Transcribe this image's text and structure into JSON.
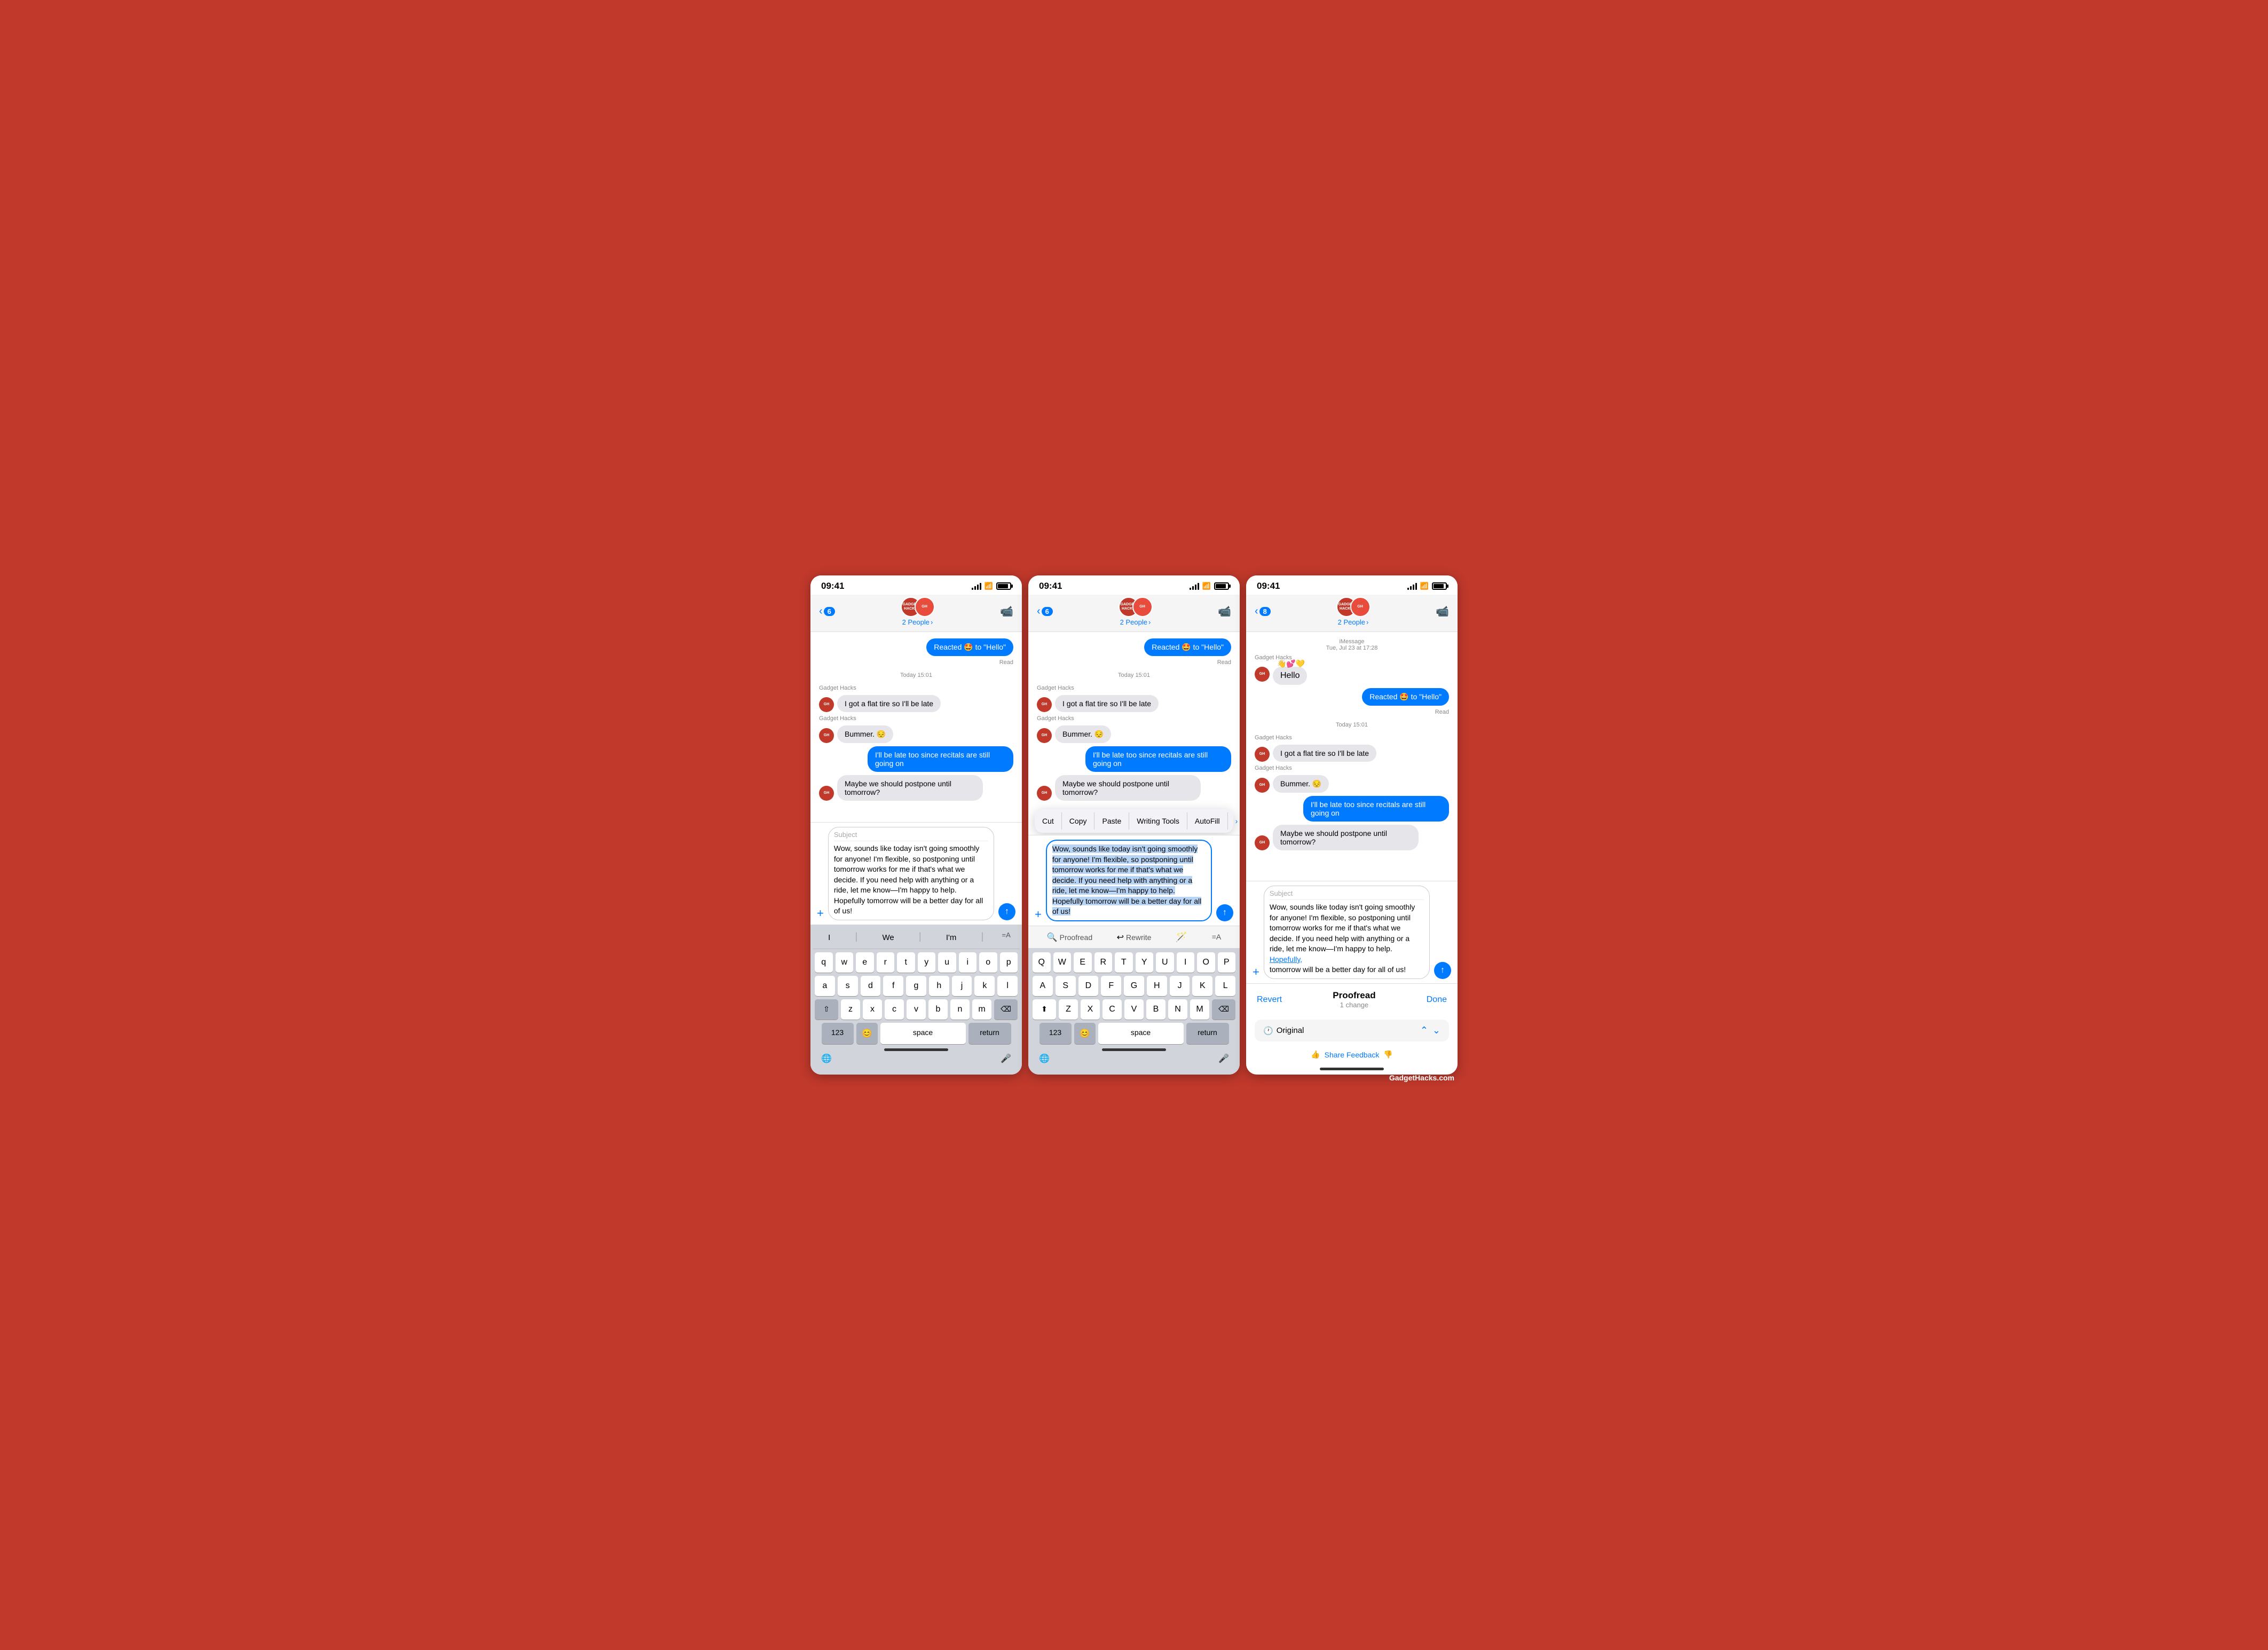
{
  "screens": [
    {
      "id": "screen1",
      "statusBar": {
        "time": "09:41",
        "signal": "●●●",
        "wifi": "WiFi",
        "battery": "100%"
      },
      "nav": {
        "backCount": "6",
        "centerTitle": "2 People",
        "hasChevron": true
      },
      "messages": [
        {
          "type": "sent-reaction",
          "text": "Reacted 🤩 to \"Hello\""
        },
        {
          "type": "read",
          "text": "Read"
        },
        {
          "type": "timestamp",
          "text": "Today 15:01"
        },
        {
          "type": "sender-label",
          "text": "Gadget Hacks"
        },
        {
          "type": "received",
          "text": "I got a flat tire so I'll be late"
        },
        {
          "type": "sender-label",
          "text": "Gadget Hacks"
        },
        {
          "type": "received",
          "text": "Bummer. 😔"
        },
        {
          "type": "sent",
          "text": "I'll be late too since recitals are still going on"
        },
        {
          "type": "received",
          "text": "Maybe we should postpone until tomorrow?"
        }
      ],
      "input": {
        "subject": "Subject",
        "text": "Wow, sounds like today isn't going smoothly for anyone! I'm flexible, so postponing until tomorrow works for me if that's what we decide. If you need help with anything or a ride, let me know—I'm happy to help. Hopefully tomorrow will be a better day for all of us!"
      },
      "keyboard": {
        "suggestions": [
          "I",
          "We",
          "I'm"
        ],
        "rows": [
          [
            "q",
            "w",
            "e",
            "r",
            "t",
            "y",
            "u",
            "i",
            "o",
            "p"
          ],
          [
            "a",
            "s",
            "d",
            "f",
            "g",
            "h",
            "j",
            "k",
            "l"
          ],
          [
            "z",
            "x",
            "c",
            "v",
            "b",
            "n",
            "m"
          ]
        ],
        "bottomRow": [
          "123",
          "😊",
          "space",
          "return"
        ]
      }
    },
    {
      "id": "screen2",
      "statusBar": {
        "time": "09:41"
      },
      "nav": {
        "backCount": "6",
        "centerTitle": "2 People"
      },
      "messages": [
        {
          "type": "sent-reaction",
          "text": "Reacted 🤩 to \"Hello\""
        },
        {
          "type": "read",
          "text": "Read"
        },
        {
          "type": "timestamp",
          "text": "Today 15:01"
        },
        {
          "type": "sender-label",
          "text": "Gadget Hacks"
        },
        {
          "type": "received",
          "text": "I got a flat tire so I'll be late"
        },
        {
          "type": "sender-label",
          "text": "Gadget Hacks"
        },
        {
          "type": "received",
          "text": "Bummer. 😔"
        },
        {
          "type": "sent",
          "text": "I'll be late too since recitals are still going on"
        },
        {
          "type": "received",
          "text": "Maybe we should postpone until tomorrow?"
        }
      ],
      "contextMenu": {
        "items": [
          "Cut",
          "Copy",
          "Paste",
          "Writing Tools",
          "AutoFill",
          "›"
        ]
      },
      "input": {
        "subject": "",
        "text": "Wow, sounds like today isn't going smoothly for anyone! I'm flexible, so postponing until tomorrow works for me if that's what we decide. If you need help with anything or a ride, let me know—I'm happy to help. Hopefully tomorrow will be a better day for all of us!"
      },
      "writingTools": {
        "items": [
          "🔍 Proofread",
          "↩ Rewrite",
          "🪄 ",
          "=A"
        ]
      },
      "keyboard": {
        "suggestions": [],
        "caps": true,
        "rows": [
          [
            "Q",
            "W",
            "E",
            "R",
            "T",
            "Y",
            "U",
            "I",
            "O",
            "P"
          ],
          [
            "A",
            "S",
            "D",
            "F",
            "G",
            "H",
            "J",
            "K",
            "L"
          ],
          [
            "Z",
            "X",
            "C",
            "V",
            "B",
            "N",
            "M"
          ]
        ],
        "bottomRow": [
          "123",
          "😊",
          "space",
          "return"
        ]
      }
    },
    {
      "id": "screen3",
      "statusBar": {
        "time": "09:41",
        "backCount": "8"
      },
      "nav": {
        "backCount": "8",
        "centerTitle": "2 People"
      },
      "iMessageHeader": "iMessage\nTue, Jul 23 at 17:28",
      "messages": [
        {
          "type": "hello-area",
          "sender": "Gadget Hacks",
          "text": "Hello",
          "reactions": "👋💕💛"
        },
        {
          "type": "sent-reaction",
          "text": "Reacted 🤩 to \"Hello\""
        },
        {
          "type": "read",
          "text": "Read"
        },
        {
          "type": "timestamp",
          "text": "Today 15:01"
        },
        {
          "type": "sender-label",
          "text": "Gadget Hacks"
        },
        {
          "type": "received",
          "text": "I got a flat tire so I'll be late"
        },
        {
          "type": "sender-label",
          "text": "Gadget Hacks"
        },
        {
          "type": "received",
          "text": "Bummer. 😔"
        },
        {
          "type": "sent",
          "text": "I'll be late too since recitals are still going on"
        },
        {
          "type": "received",
          "text": "Maybe we should postpone until tomorrow?"
        }
      ],
      "input": {
        "subject": "Subject",
        "text": "Wow, sounds like today isn't going smoothly for anyone! I'm flexible, so postponing until tomorrow works for me if that's what we decide. If you need help with anything or a ride, let me know—I'm happy to help. Hopefully,\ntomorrow will be a better day for all of us!",
        "highlightWord": "Hopefully,"
      },
      "proofread": {
        "revertLabel": "Revert",
        "title": "Proofread",
        "changeCount": "1 change",
        "doneLabel": "Done",
        "originalLabel": "Original",
        "feedbackLabel": "Share Feedback"
      }
    }
  ],
  "watermark": "GadgetHacks.com"
}
